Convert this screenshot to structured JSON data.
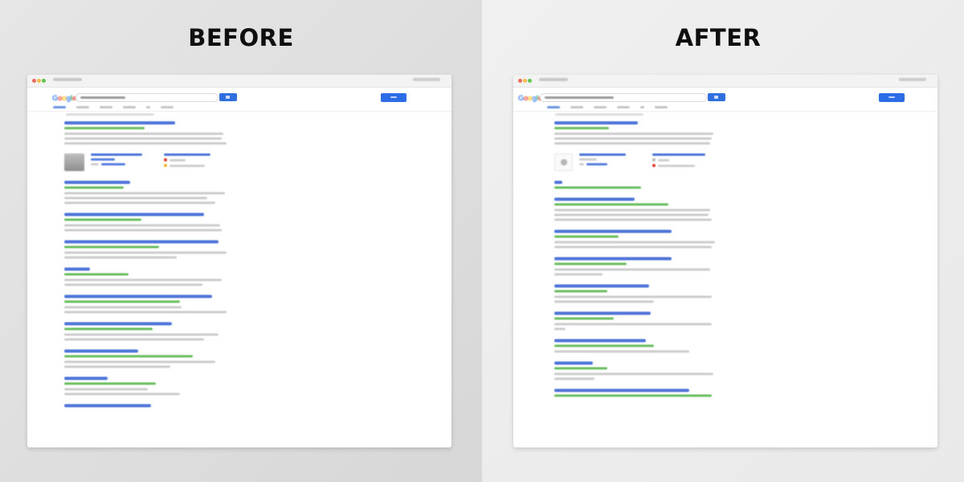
{
  "before": {
    "heading": "BEFORE",
    "logo": "Google"
  },
  "after": {
    "heading": "AFTER",
    "logo": "Google"
  }
}
